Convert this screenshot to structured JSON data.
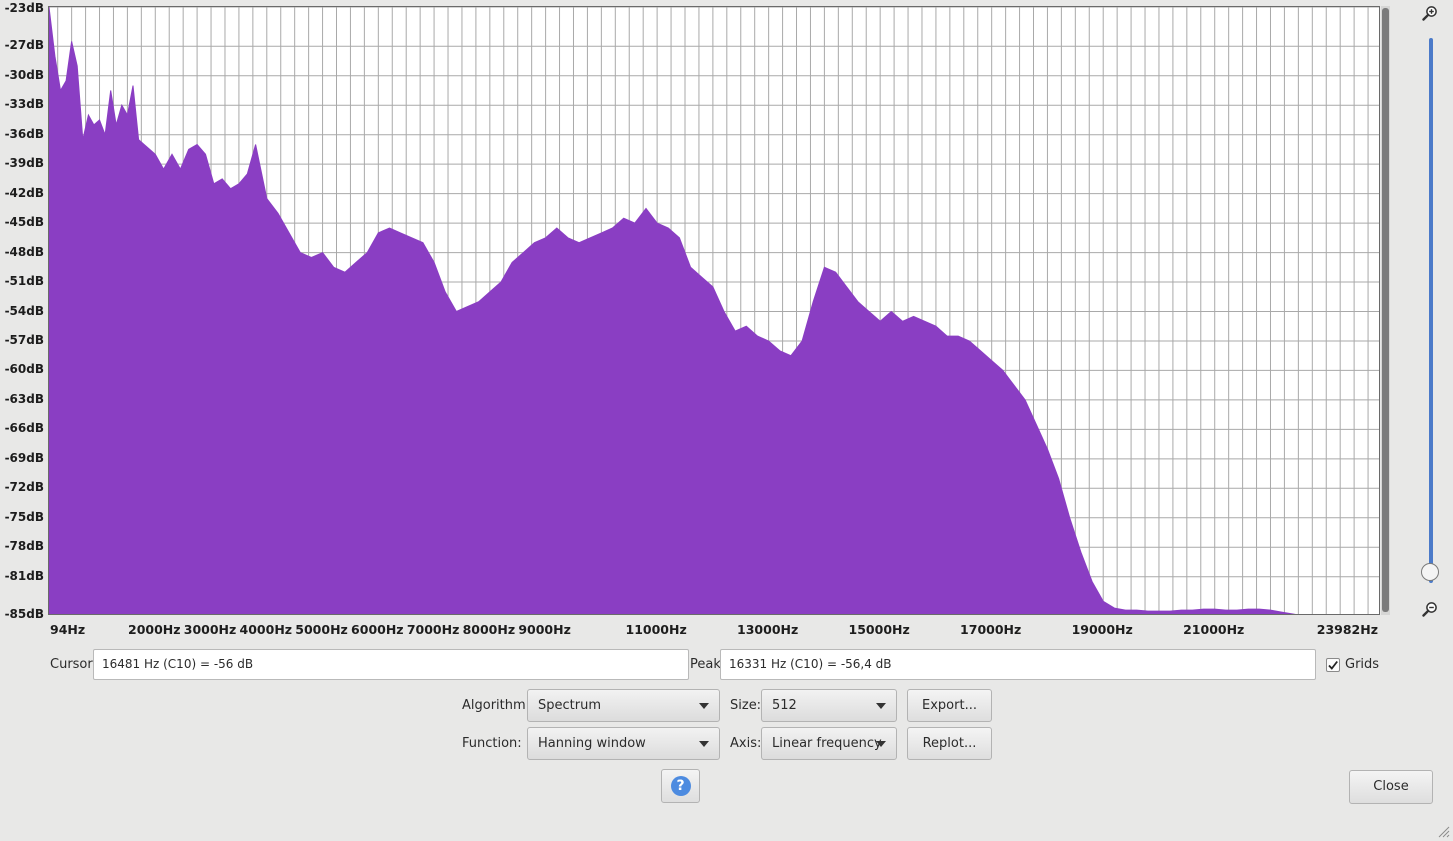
{
  "chart_data": {
    "type": "area",
    "x_scale": "linear",
    "xlim": [
      94,
      23982
    ],
    "ylim": [
      -85,
      -23
    ],
    "x_tick_labels": [
      "94Hz",
      "2000Hz",
      "3000Hz",
      "4000Hz",
      "5000Hz",
      "6000Hz",
      "7000Hz",
      "8000Hz",
      "9000Hz",
      "11000Hz",
      "13000Hz",
      "15000Hz",
      "17000Hz",
      "19000Hz",
      "21000Hz",
      "23982Hz"
    ],
    "x_tick_values": [
      94,
      2000,
      3000,
      4000,
      5000,
      6000,
      7000,
      8000,
      9000,
      11000,
      13000,
      15000,
      17000,
      19000,
      21000,
      23982
    ],
    "y_tick_labels": [
      "-23dB",
      "-27dB",
      "-30dB",
      "-33dB",
      "-36dB",
      "-39dB",
      "-42dB",
      "-45dB",
      "-48dB",
      "-51dB",
      "-54dB",
      "-57dB",
      "-60dB",
      "-63dB",
      "-66dB",
      "-69dB",
      "-72dB",
      "-75dB",
      "-78dB",
      "-81dB",
      "-85dB"
    ],
    "y_tick_values": [
      -23,
      -27,
      -30,
      -33,
      -36,
      -39,
      -42,
      -45,
      -48,
      -51,
      -54,
      -57,
      -60,
      -63,
      -66,
      -69,
      -72,
      -75,
      -78,
      -81,
      -85
    ],
    "grid": true,
    "fill_color": "#8a3ec3",
    "x": [
      94,
      200,
      300,
      400,
      500,
      600,
      700,
      800,
      900,
      1000,
      1100,
      1200,
      1300,
      1400,
      1500,
      1600,
      1700,
      1800,
      1900,
      2000,
      2150,
      2300,
      2450,
      2600,
      2750,
      2900,
      3050,
      3200,
      3350,
      3500,
      3650,
      3800,
      4000,
      4200,
      4400,
      4600,
      4800,
      5000,
      5200,
      5400,
      5600,
      5800,
      6000,
      6200,
      6400,
      6600,
      6800,
      7000,
      7200,
      7400,
      7600,
      7800,
      8000,
      8200,
      8400,
      8600,
      8800,
      9000,
      9200,
      9400,
      9600,
      9800,
      10000,
      10200,
      10400,
      10600,
      10800,
      11000,
      11200,
      11400,
      11600,
      11800,
      12000,
      12200,
      12400,
      12600,
      12800,
      13000,
      13200,
      13400,
      13600,
      13800,
      14000,
      14200,
      14400,
      14600,
      14800,
      15000,
      15200,
      15400,
      15600,
      15800,
      16000,
      16200,
      16400,
      16600,
      16800,
      17000,
      17200,
      17400,
      17600,
      17800,
      18000,
      18200,
      18400,
      18600,
      18800,
      19000,
      19200,
      19400,
      19600,
      19800,
      20000,
      20200,
      20400,
      20600,
      20800,
      21000,
      21200,
      21400,
      21600,
      21800,
      22000,
      22200,
      22400,
      22600,
      22800,
      23000,
      23200,
      23400,
      23600,
      23982
    ],
    "values": [
      -23,
      -28,
      -31.5,
      -30.5,
      -26.5,
      -29,
      -36.5,
      -34,
      -35,
      -34.5,
      -36,
      -31.5,
      -35,
      -33,
      -34,
      -31,
      -36.5,
      -37,
      -37.5,
      -38,
      -39.5,
      -38,
      -39.5,
      -37.5,
      -37,
      -38,
      -41,
      -40.5,
      -41.5,
      -41,
      -40,
      -37,
      -42.5,
      -44,
      -46,
      -48,
      -48.5,
      -48,
      -49.5,
      -50,
      -49,
      -48,
      -46,
      -45.5,
      -46,
      -46.5,
      -47,
      -49,
      -52,
      -54,
      -53.5,
      -53,
      -52,
      -51,
      -49,
      -48,
      -47,
      -46.5,
      -45.5,
      -46.5,
      -47,
      -46.5,
      -46,
      -45.5,
      -44.5,
      -45,
      -43.5,
      -45,
      -45.5,
      -46.5,
      -49.5,
      -50.5,
      -51.5,
      -54,
      -56,
      -55.5,
      -56.5,
      -57,
      -58,
      -58.5,
      -57,
      -53,
      -49.5,
      -50,
      -51.5,
      -53,
      -54,
      -55,
      -54,
      -55,
      -54.5,
      -55,
      -55.5,
      -56.5,
      -56.5,
      -57,
      -58,
      -59,
      -60,
      -61.5,
      -63,
      -65.5,
      -68,
      -71,
      -75,
      -78.5,
      -81.5,
      -83.5,
      -84.2,
      -84.4,
      -84.4,
      -84.5,
      -84.5,
      -84.5,
      -84.4,
      -84.4,
      -84.3,
      -84.3,
      -84.4,
      -84.4,
      -84.3,
      -84.3,
      -84.4,
      -84.6,
      -84.8,
      -85,
      -85.2,
      -85.4,
      -85.6,
      -85.9,
      -86.5,
      -87
    ]
  },
  "cursor": {
    "label": "Cursor:",
    "value": "16481 Hz (C10) = -56 dB"
  },
  "peak": {
    "label": "Peak:",
    "value": "16331 Hz (C10) = -56,4 dB"
  },
  "grids": {
    "label": "Grids",
    "checked": true
  },
  "controls": {
    "algorithm_label": "Algorithm:",
    "algorithm_value": "Spectrum",
    "size_label": "Size:",
    "size_value": "512",
    "function_label": "Function:",
    "function_value": "Hanning window",
    "axis_label": "Axis:",
    "axis_value": "Linear frequency",
    "export_label": "Export...",
    "replot_label": "Replot...",
    "help_glyph": "?",
    "close_label": "Close"
  },
  "zoom": {
    "level": 0.02
  },
  "icons": {
    "zoom_in": "zoom-in-icon",
    "zoom_out": "zoom-out-icon",
    "help": "help-icon",
    "resize": "resize-grip-icon"
  }
}
